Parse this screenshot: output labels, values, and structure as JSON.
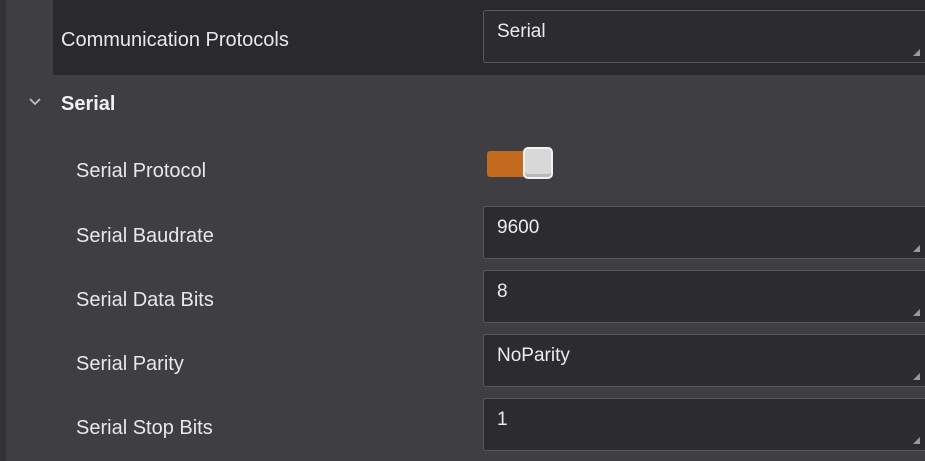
{
  "comm": {
    "label": "Communication Protocols",
    "value": "Serial"
  },
  "section": {
    "title": "Serial",
    "expanded": true
  },
  "params": {
    "protocol": {
      "label": "Serial Protocol",
      "enabled": true
    },
    "baudrate": {
      "label": "Serial Baudrate",
      "value": "9600"
    },
    "data_bits": {
      "label": "Serial Data Bits",
      "value": "8"
    },
    "parity": {
      "label": "Serial Parity",
      "value": "NoParity"
    },
    "stop_bits": {
      "label": "Serial Stop Bits",
      "value": "1"
    }
  },
  "colors": {
    "background": "#3f3f43",
    "field": "#2c2c30",
    "toggle_on": "#c46a1e"
  }
}
